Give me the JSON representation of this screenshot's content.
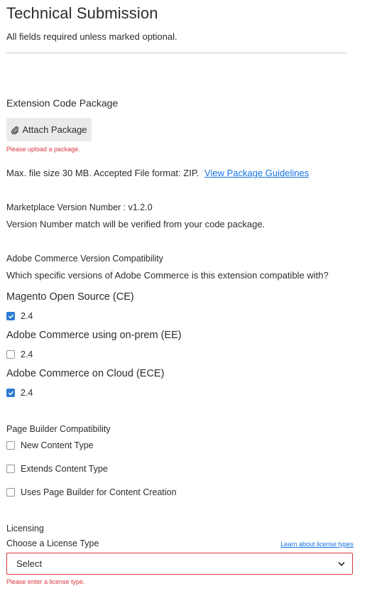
{
  "header": {
    "title": "Technical Submission",
    "subtitle": "All fields required unless marked optional."
  },
  "package": {
    "section_title": "Extension Code Package",
    "attach_label": "Attach Package",
    "error": "Please upload a package.",
    "info_text": "Max. file size 30 MB. Accepted File format: ZIP.",
    "guidelines_link": "View Package Guidelines"
  },
  "version": {
    "label": "Marketplace Version Number : v1.2.0",
    "note": "Version Number match will be verified from your code package."
  },
  "compatibility": {
    "title": "Adobe Commerce Version Compatibility",
    "question": "Which specific versions of Adobe Commerce is this extension compatible with?",
    "groups": [
      {
        "name": "Magento Open Source (CE)",
        "option": "2.4",
        "checked": true
      },
      {
        "name": "Adobe Commerce using on-prem (EE)",
        "option": "2.4",
        "checked": false
      },
      {
        "name": "Adobe Commerce on Cloud (ECE)",
        "option": "2.4",
        "checked": true
      }
    ]
  },
  "page_builder": {
    "title": "Page Builder Compatibility",
    "options": [
      {
        "label": "New Content Type",
        "checked": false
      },
      {
        "label": "Extends Content Type",
        "checked": false
      },
      {
        "label": "Uses Page Builder for Content Creation",
        "checked": false
      }
    ]
  },
  "licensing": {
    "title": "Licensing",
    "label": "Choose a License Type",
    "learn_link": "Learn about license types",
    "select_value": "Select",
    "error": "Please enter a license type."
  },
  "colors": {
    "accent": "#1473e6",
    "checkbox_checked": "#2d7dd2",
    "error": "#d7373f"
  },
  "icons": {
    "attach": "paperclip-icon",
    "check": "checkmark-icon",
    "dropdown": "chevron-down-icon"
  }
}
